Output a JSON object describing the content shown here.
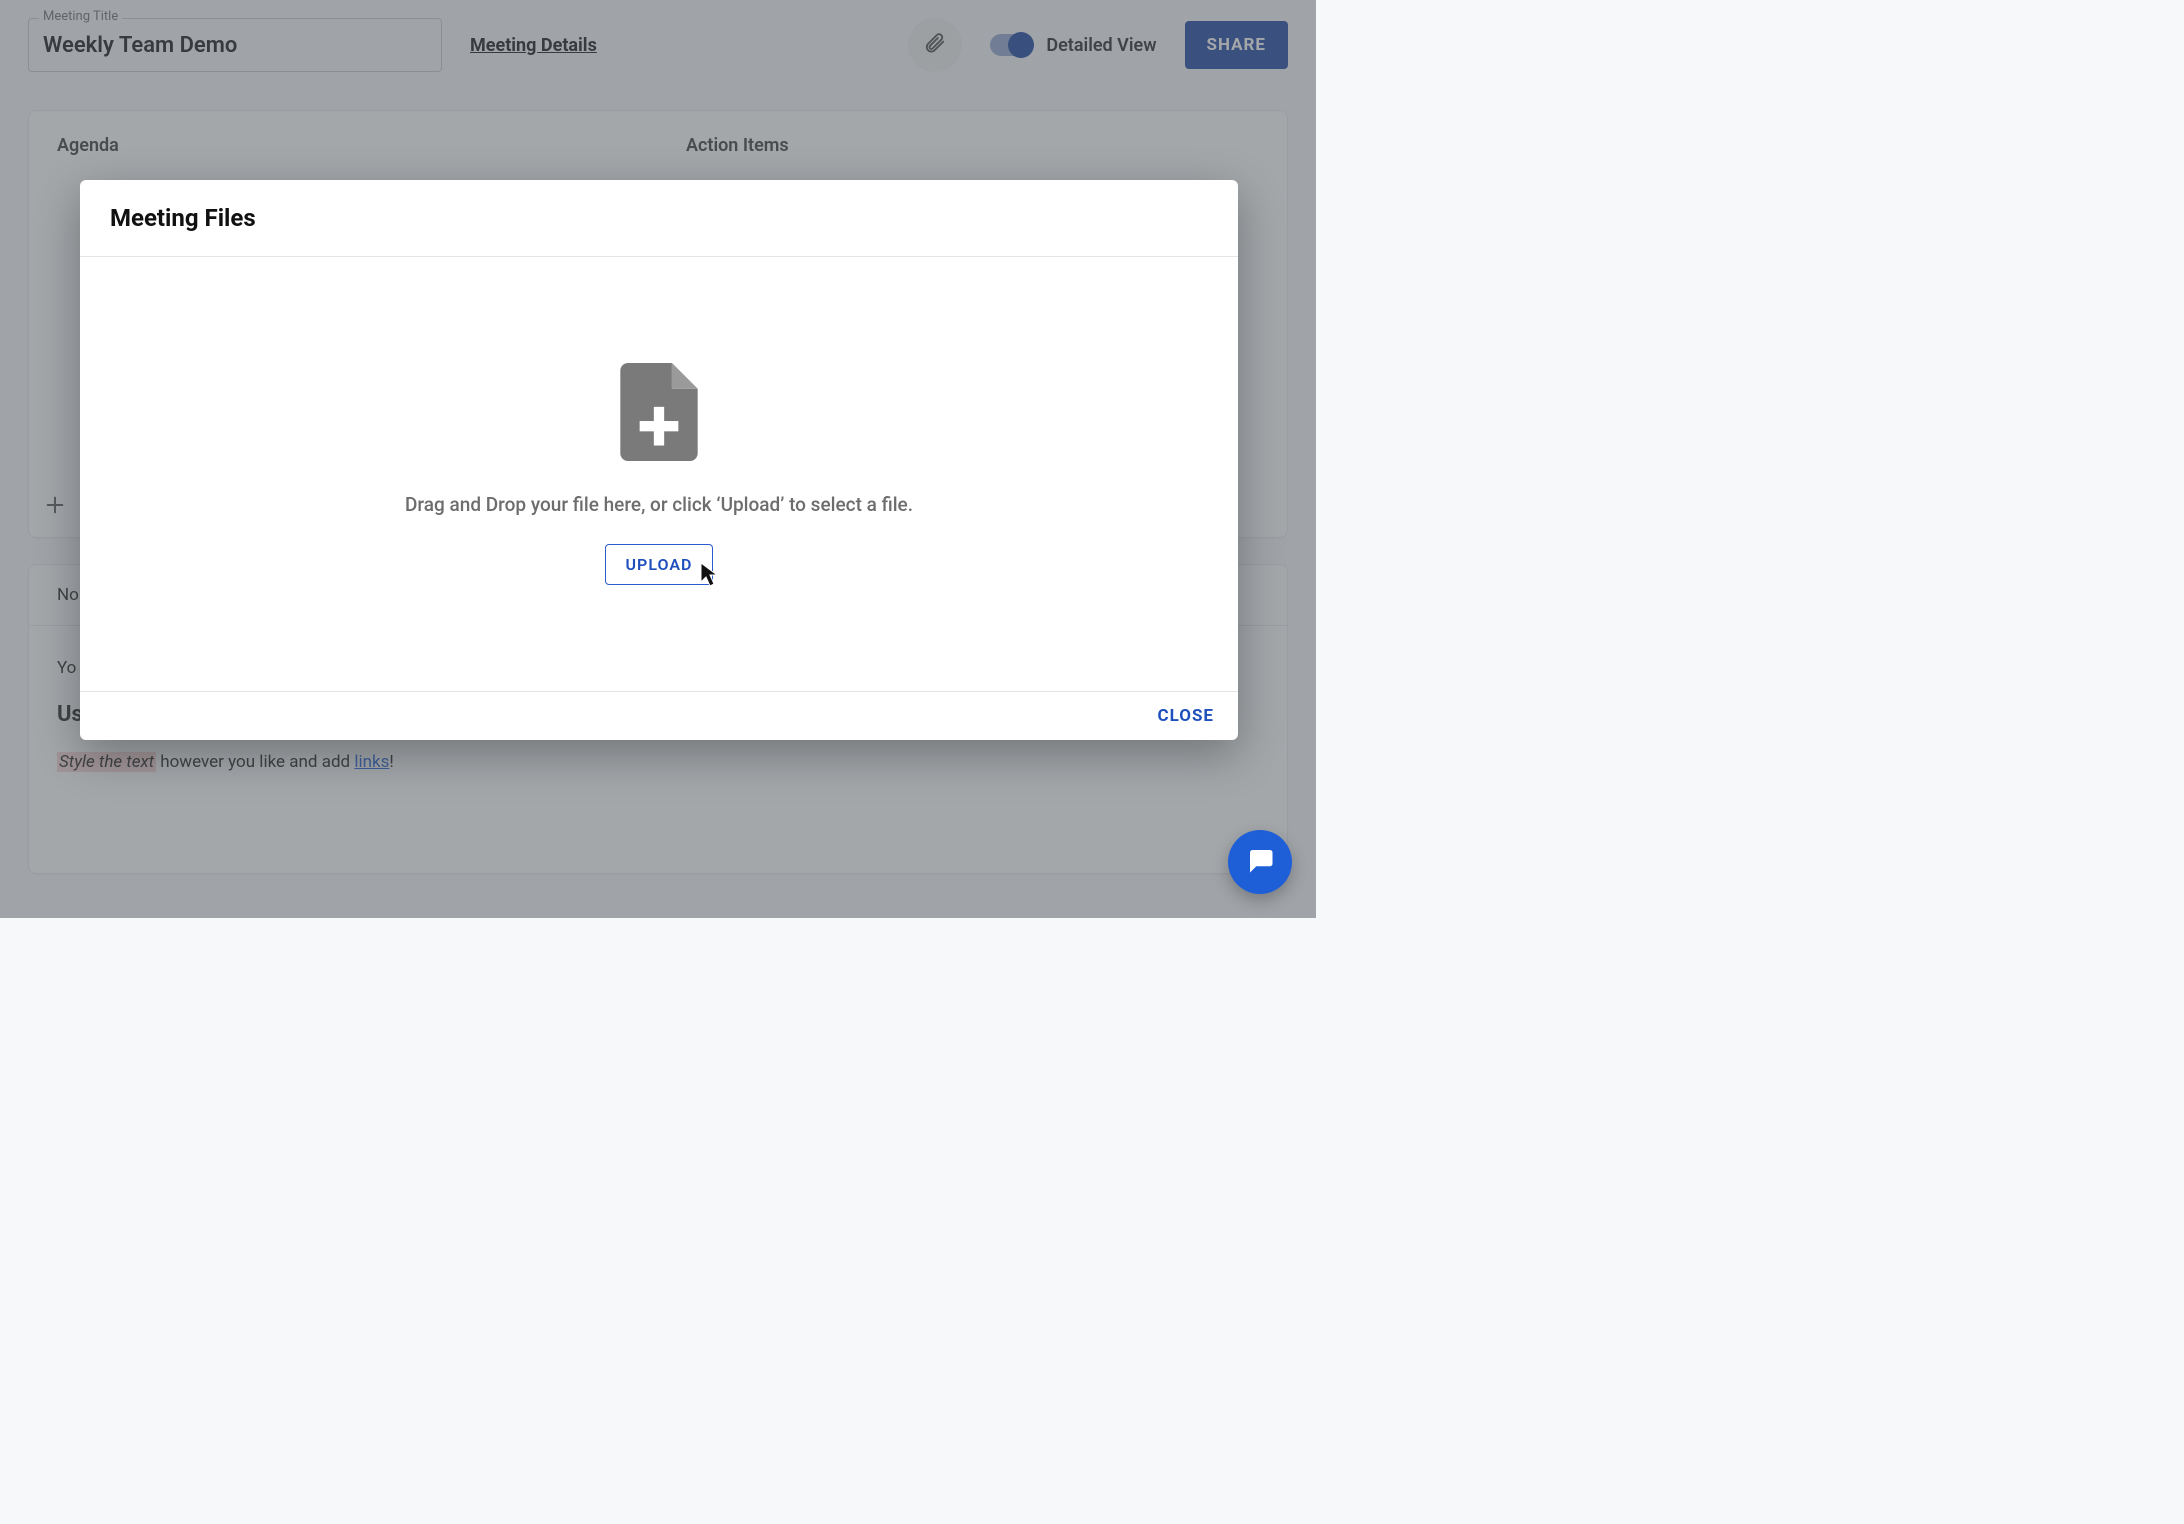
{
  "header": {
    "title_field_label": "Meeting Title",
    "title_value": "Weekly Team Demo",
    "meeting_details_link": "Meeting Details",
    "detailed_view_label": "Detailed View",
    "share_button": "SHARE"
  },
  "panel": {
    "agenda_heading": "Agenda",
    "action_items_heading": "Action Items"
  },
  "notes": {
    "header_prefix": "No",
    "line1_prefix": "Yo",
    "line2_prefix": "Us",
    "styled_span": "Style the text",
    "style_rest": " however you like and add ",
    "link_text": "links",
    "exclaim": "!"
  },
  "modal": {
    "title": "Meeting Files",
    "drop_text": "Drag and Drop your file here, or click ‘Upload’ to select a file.",
    "upload_button": "UPLOAD",
    "close_button": "CLOSE"
  }
}
